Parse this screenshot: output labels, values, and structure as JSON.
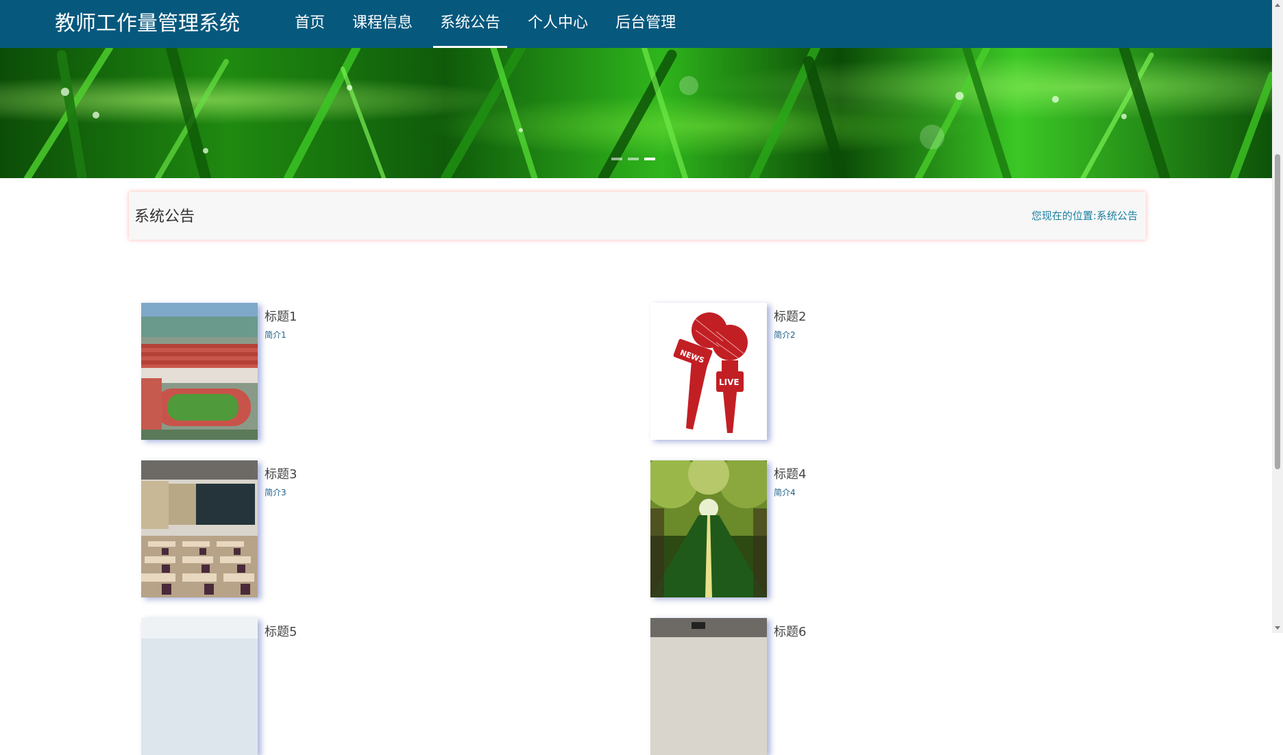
{
  "app": {
    "title": "教师工作量管理系统"
  },
  "nav": {
    "items": [
      {
        "label": "首页"
      },
      {
        "label": "课程信息"
      },
      {
        "label": "系统公告"
      },
      {
        "label": "个人中心"
      },
      {
        "label": "后台管理"
      }
    ],
    "active_index": 2
  },
  "banner": {
    "slides": 3,
    "active_slide": 2
  },
  "section": {
    "title": "系统公告",
    "breadcrumb_prefix": "您现在的位置:",
    "breadcrumb_current": "系统公告"
  },
  "notices": [
    {
      "title": "标题1",
      "summary": "简介1",
      "image": "campus-aerial"
    },
    {
      "title": "标题2",
      "summary": "简介2",
      "image": "news-live-microphones"
    },
    {
      "title": "标题3",
      "summary": "简介3",
      "image": "classroom"
    },
    {
      "title": "标题4",
      "summary": "简介4",
      "image": "tree-lined-road"
    },
    {
      "title": "标题5",
      "summary": "",
      "image": "light-sky"
    },
    {
      "title": "标题6",
      "summary": "",
      "image": "classroom"
    }
  ],
  "colors": {
    "header_bg": "#07587d",
    "accent_link": "#1a7fa0",
    "news_red": "#c21f24"
  }
}
